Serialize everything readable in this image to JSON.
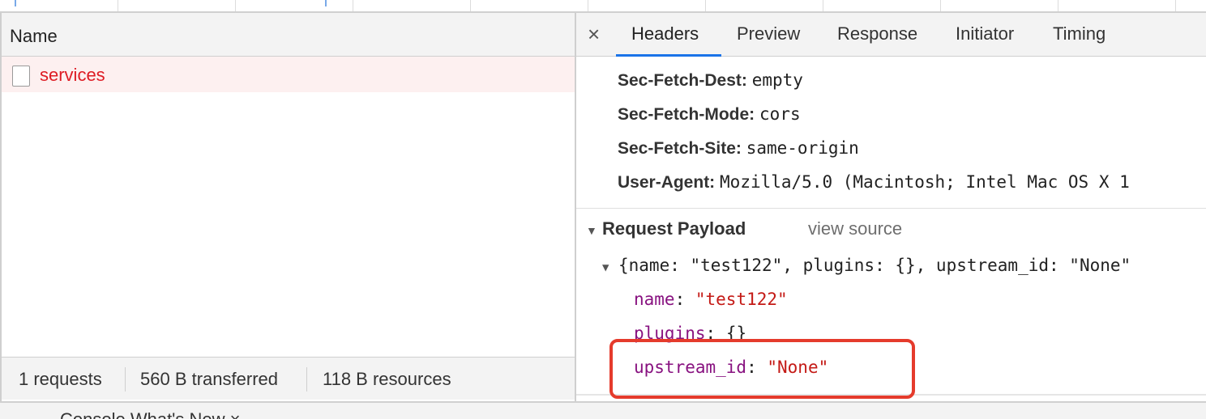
{
  "left_panel": {
    "column_header": "Name",
    "request": {
      "name": "services"
    },
    "status_bar": {
      "requests": "1 requests",
      "transferred": "560 B transferred",
      "resources": "118 B resources"
    }
  },
  "right_panel": {
    "close_label": "×",
    "tabs": [
      {
        "label": "Headers",
        "active": true
      },
      {
        "label": "Preview",
        "active": false
      },
      {
        "label": "Response",
        "active": false
      },
      {
        "label": "Initiator",
        "active": false
      },
      {
        "label": "Timing",
        "active": false
      }
    ],
    "request_headers": [
      {
        "name": "Sec-Fetch-Dest:",
        "value": "empty"
      },
      {
        "name": "Sec-Fetch-Mode:",
        "value": "cors"
      },
      {
        "name": "Sec-Fetch-Site:",
        "value": "same-origin"
      },
      {
        "name": "User-Agent:",
        "value": "Mozilla/5.0 (Macintosh; Intel Mac OS X 1"
      }
    ],
    "payload": {
      "title": "Request Payload",
      "view_source": "view source",
      "summary": "{name: \"test122\", plugins: {}, upstream_id: \"None\"",
      "properties": [
        {
          "key": "name",
          "colon": ": ",
          "value": "\"test122\""
        },
        {
          "key": "plugins",
          "colon": ": ",
          "value": "{}"
        },
        {
          "key": "upstream_id",
          "colon": ": ",
          "value": "\"None\""
        }
      ]
    }
  },
  "bottom_strip": {
    "text": "Console   What's New   ×"
  },
  "colors": {
    "accent_tab": "#1a73e8",
    "error_text": "#de1c24",
    "highlight_annotation": "#e53b2c",
    "json_key": "#881280",
    "json_string": "#c41a16"
  },
  "icons": [
    "file-icon",
    "close-icon",
    "expand-triangle-icon"
  ]
}
